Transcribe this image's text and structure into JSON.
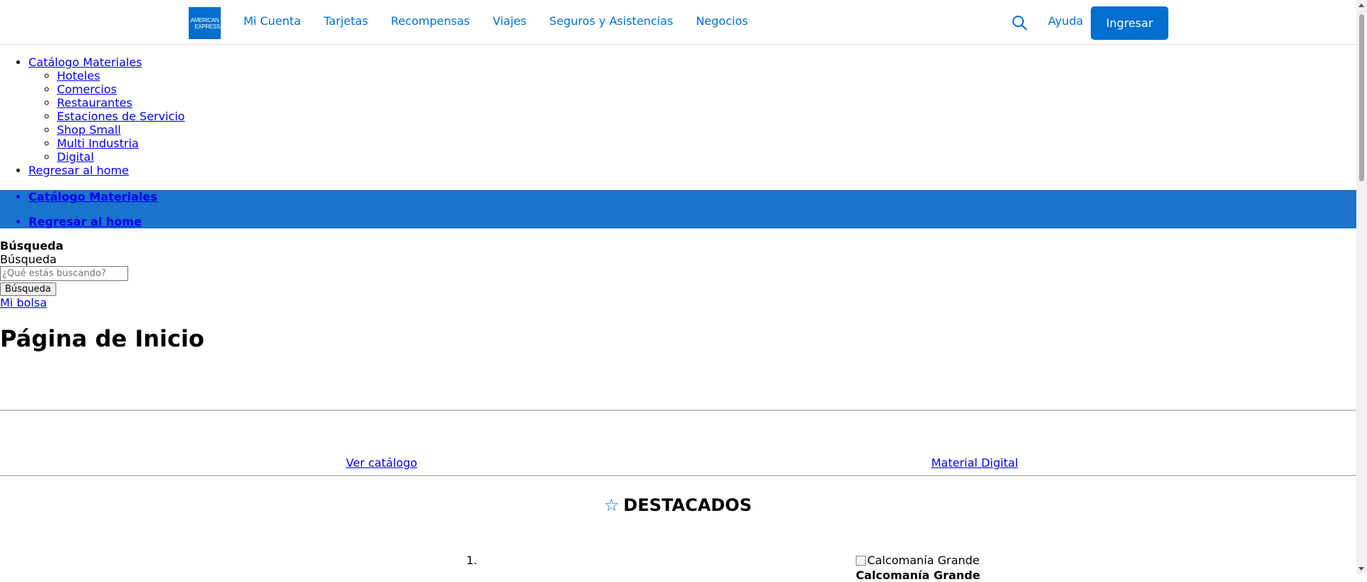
{
  "header": {
    "logo_line1": "AMERICAN",
    "logo_line2": "EXPRESS",
    "nav": [
      "Mi Cuenta",
      "Tarjetas",
      "Recompensas",
      "Viajes",
      "Seguros y Asistencias",
      "Negocios"
    ],
    "help_label": "Ayuda",
    "login_label": "Ingresar"
  },
  "menu": {
    "catalog": "Catálogo Materiales",
    "sub_items": [
      "Hoteles",
      "Comercios",
      "Restaurantes",
      "Estaciones de Servicio",
      "Shop Small",
      "Multi Industria",
      "Digital"
    ],
    "home": "Regresar al home"
  },
  "bluebar": {
    "catalog": "Catálogo Materiales",
    "home": "Regresar al home"
  },
  "search": {
    "title": "Búsqueda",
    "label": "Búsqueda",
    "placeholder": "¿Qué estás buscando?",
    "button": "Búsqueda",
    "bag": "Mi bolsa"
  },
  "main": {
    "page_title": "Página de Inicio",
    "link_catalog": "Ver catálogo",
    "link_digital": "Material Digital",
    "featured_icon": "star-icon",
    "featured_title": "DESTACADOS",
    "list_number": "1.",
    "product_alt": "Calcomanía Grande",
    "product_name": "Calcomanía Grande"
  },
  "colors": {
    "brand_blue": "#016fd0",
    "bar_blue": "#1a73cc"
  }
}
